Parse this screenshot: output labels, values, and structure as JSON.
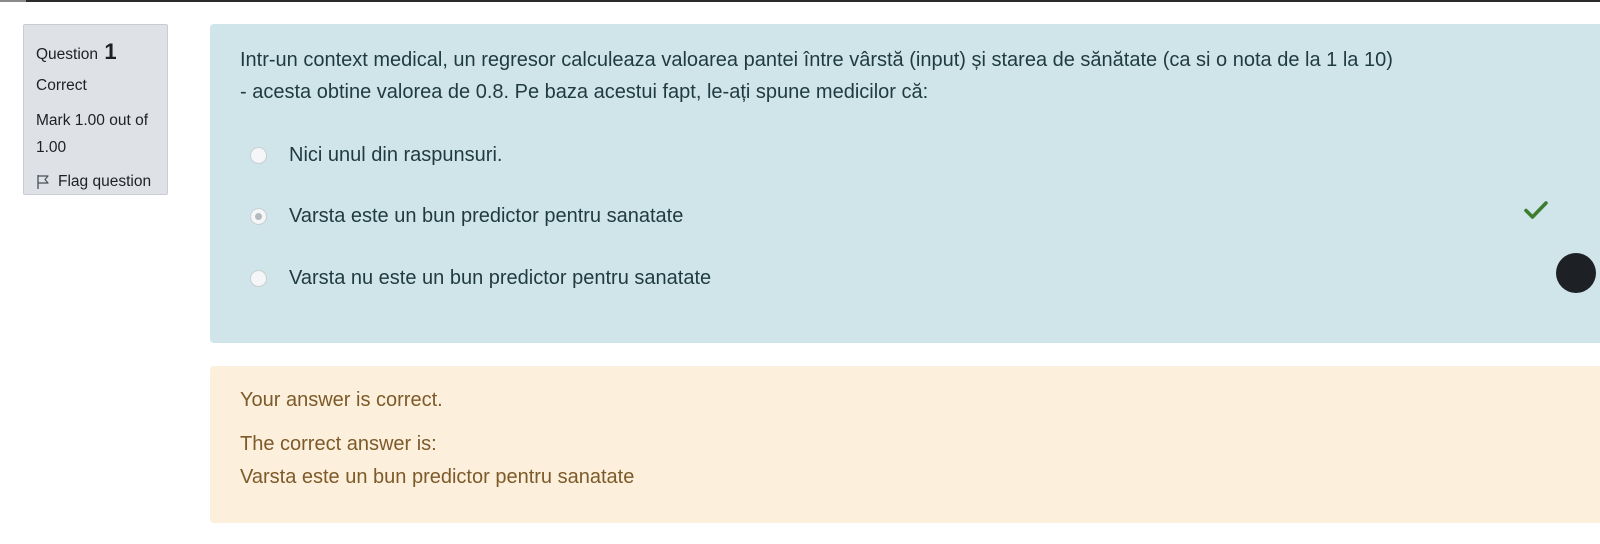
{
  "question_info": {
    "label": "Question",
    "number": "1",
    "state": "Correct",
    "grade": "Mark 1.00 out of 1.00",
    "flag_label": "Flag question"
  },
  "question": {
    "text_line1": "Intr-un context medical, un regresor calculeaza valoarea pantei între vârstă (input) și starea de sănătate (ca si o nota de la 1 la 10)",
    "text_line2": "- acesta obtine valorea de 0.8. Pe baza acestui fapt, le-ați spune medicilor că:",
    "answers": [
      {
        "label": "Nici unul din raspunsuri.",
        "selected": false,
        "correct": false
      },
      {
        "label": "Varsta este un bun predictor pentru sanatate",
        "selected": true,
        "correct": true
      },
      {
        "label": "Varsta nu este un bun predictor pentru sanatate",
        "selected": false,
        "correct": false
      }
    ]
  },
  "feedback": {
    "status": "Your answer is correct.",
    "right_answer_title": "The correct answer is:",
    "right_answer_value": "Varsta este un bun predictor pentru sanatate"
  },
  "colors": {
    "content_bg": "#cfe5ea",
    "feedback_bg": "#fcefdc",
    "feedback_text": "#7d5a29",
    "check_green": "#3e7d2f",
    "info_bg": "#dee2e6"
  }
}
